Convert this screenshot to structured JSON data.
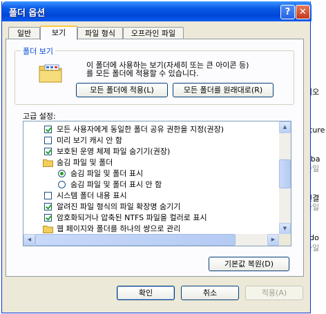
{
  "window": {
    "title": "폴더 옵션",
    "help_label": "?",
    "close_label": "✕"
  },
  "tabs": [
    {
      "label": "일반"
    },
    {
      "label": "보기"
    },
    {
      "label": "파일 형식"
    },
    {
      "label": "오프라인 파일"
    }
  ],
  "folder_view": {
    "group_label": "폴더 보기",
    "description_line1": "이 폴더에 사용하는 보기(자세히 또는 큰 아이콘 등)",
    "description_line2": "를 모든 폴더에  적용할 수 있습니다.",
    "apply_all_label": "모든 폴더에 적용(L)",
    "reset_all_label": "모든 폴더를 원래대로(R)"
  },
  "advanced": {
    "label": "고급 설정:",
    "items": [
      {
        "type": "checkbox",
        "checked": true,
        "label": "모든 사용자에게 동일한 폴더 공유 권한을 지정(권장)"
      },
      {
        "type": "checkbox",
        "checked": false,
        "label": "미리 보기 캐시 안 함"
      },
      {
        "type": "checkbox",
        "checked": true,
        "label": "보호된 운영 체제 파일 숨기기(권장)"
      },
      {
        "type": "folder",
        "label": "숨김 파일 및 폴더"
      },
      {
        "type": "radio",
        "checked": true,
        "label": "숨김 파일 및 폴더 표시"
      },
      {
        "type": "radio",
        "checked": false,
        "label": "숨김 파일 및 폴더 표시 안 함"
      },
      {
        "type": "checkbox",
        "checked": false,
        "label": "시스템 폴더 내용 표시"
      },
      {
        "type": "checkbox",
        "checked": true,
        "label": "알려진 파일 형식의 파일 확장명 숨기기"
      },
      {
        "type": "checkbox",
        "checked": true,
        "label": "암호화되거나 압축된 NTFS 파일을 컬러로 표시"
      },
      {
        "type": "folder",
        "label": "웹 페이지와 폴더를 하나의 쌍으로 관리"
      }
    ],
    "restore_defaults_label": "기본값 복원(D)"
  },
  "footer": {
    "ok_label": "확인",
    "cancel_label": "취소",
    "apply_label": "적용(A)"
  },
  "background": {
    "texts": [
      "이오",
      "cture",
      "t.ba",
      "파일",
      "연결",
      "파일",
      "Ldo",
      "파일"
    ]
  }
}
